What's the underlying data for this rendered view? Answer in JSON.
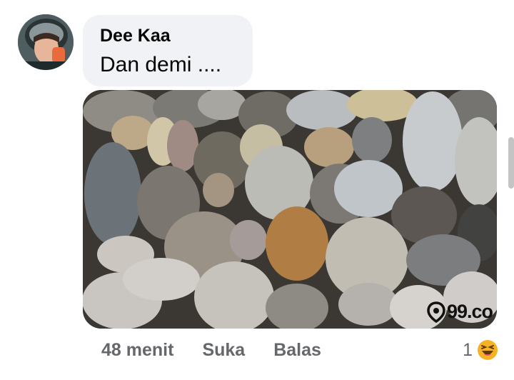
{
  "comment": {
    "author": "Dee Kaa",
    "text": "Dan demi ....",
    "avatar_icon": "user-avatar-photo"
  },
  "attachment": {
    "image_subject": "river-stones-photo",
    "watermark": "99.co",
    "watermark_icon": "location-pin-icon"
  },
  "actions": {
    "time": "48 menit",
    "like_label": "Suka",
    "reply_label": "Balas"
  },
  "reactions": {
    "count": "1",
    "icon": "haha-emoji-icon"
  },
  "colors": {
    "bubble": "#f0f2f5",
    "meta_text": "#65676b",
    "reaction": "#f7b125"
  }
}
